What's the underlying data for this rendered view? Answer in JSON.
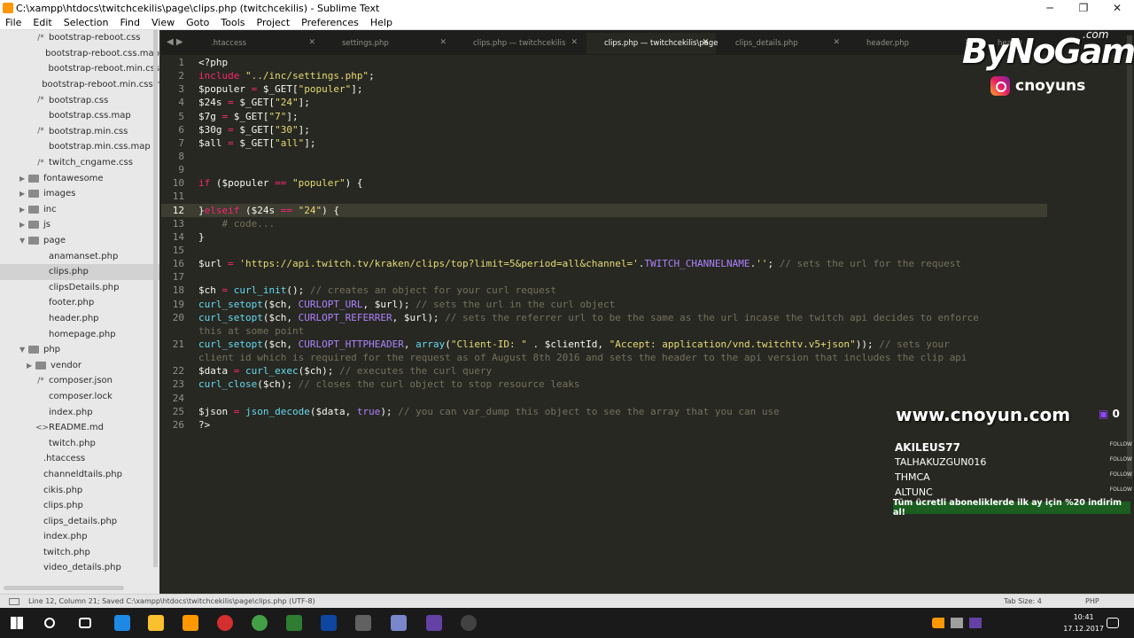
{
  "window": {
    "title": "C:\\xampp\\htdocs\\twitchcekilis\\page\\clips.php (twitchcekilis) - Sublime Text",
    "minimize": "─",
    "maximize": "❐",
    "close": "✕"
  },
  "menu": [
    "File",
    "Edit",
    "Selection",
    "Find",
    "View",
    "Goto",
    "Tools",
    "Project",
    "Preferences",
    "Help"
  ],
  "sidebar": {
    "items": [
      {
        "label": "bootstrap-reboot.css",
        "kind": "file",
        "glyph": "/*"
      },
      {
        "label": "bootstrap-reboot.css.map",
        "kind": "file",
        "glyph": ""
      },
      {
        "label": "bootstrap-reboot.min.css",
        "kind": "file",
        "glyph": ""
      },
      {
        "label": "bootstrap-reboot.min.css.r",
        "kind": "file",
        "glyph": ""
      },
      {
        "label": "bootstrap.css",
        "kind": "file",
        "glyph": "/*"
      },
      {
        "label": "bootstrap.css.map",
        "kind": "file",
        "glyph": ""
      },
      {
        "label": "bootstrap.min.css",
        "kind": "file",
        "glyph": "/*"
      },
      {
        "label": "bootstrap.min.css.map",
        "kind": "file",
        "glyph": ""
      },
      {
        "label": "twitch_cngame.css",
        "kind": "file",
        "glyph": "/*"
      },
      {
        "label": "fontawesome",
        "kind": "folder-closed"
      },
      {
        "label": "images",
        "kind": "folder-closed"
      },
      {
        "label": "inc",
        "kind": "folder-closed"
      },
      {
        "label": "js",
        "kind": "folder-closed"
      },
      {
        "label": "page",
        "kind": "folder-open"
      },
      {
        "label": "anamanset.php",
        "kind": "file",
        "glyph": ""
      },
      {
        "label": "clips.php",
        "kind": "file",
        "glyph": "",
        "selected": true
      },
      {
        "label": "clipsDetails.php",
        "kind": "file",
        "glyph": ""
      },
      {
        "label": "footer.php",
        "kind": "file",
        "glyph": ""
      },
      {
        "label": "header.php",
        "kind": "file",
        "glyph": ""
      },
      {
        "label": "homepage.php",
        "kind": "file",
        "glyph": ""
      },
      {
        "label": "php",
        "kind": "folder-open"
      },
      {
        "label": "vendor",
        "kind": "folder-closed-nested"
      },
      {
        "label": "composer.json",
        "kind": "file",
        "glyph": "/*"
      },
      {
        "label": "composer.lock",
        "kind": "file",
        "glyph": ""
      },
      {
        "label": "index.php",
        "kind": "file",
        "glyph": ""
      },
      {
        "label": "README.md",
        "kind": "file",
        "glyph": "<>"
      },
      {
        "label": "twitch.php",
        "kind": "file",
        "glyph": ""
      },
      {
        "label": ".htaccess",
        "kind": "root-file",
        "glyph": ""
      },
      {
        "label": "channeldtails.php",
        "kind": "root-file",
        "glyph": ""
      },
      {
        "label": "cikis.php",
        "kind": "root-file",
        "glyph": ""
      },
      {
        "label": "clips.php",
        "kind": "root-file",
        "glyph": ""
      },
      {
        "label": "clips_details.php",
        "kind": "root-file",
        "glyph": ""
      },
      {
        "label": "index.php",
        "kind": "root-file",
        "glyph": ""
      },
      {
        "label": "twitch.php",
        "kind": "root-file",
        "glyph": ""
      },
      {
        "label": "video_details.php",
        "kind": "root-file",
        "glyph": ""
      }
    ]
  },
  "tabs": [
    {
      "label": ".htaccess",
      "close": "✕"
    },
    {
      "label": "settings.php",
      "close": "✕"
    },
    {
      "label": "clips.php — twitchcekilis",
      "close": "✕"
    },
    {
      "label": "clips.php — twitchcekilis\\page",
      "close": "✕",
      "active": true
    },
    {
      "label": "clips_details.php",
      "close": "✕"
    },
    {
      "label": "header.php",
      "close": "✕"
    },
    {
      "label": "headD",
      "close": ""
    }
  ],
  "code": {
    "current_line": 12,
    "lines": [
      {
        "n": "1",
        "segs": [
          [
            "",
            "<?php"
          ]
        ]
      },
      {
        "n": "2",
        "segs": [
          [
            "kw",
            "include"
          ],
          [
            "",
            " "
          ],
          [
            "str",
            "\"../inc/settings.php\""
          ],
          [
            "",
            ";"
          ]
        ]
      },
      {
        "n": "3",
        "segs": [
          [
            "",
            "$populer "
          ],
          [
            "kw",
            "="
          ],
          [
            "",
            " $_GET["
          ],
          [
            "str",
            "\"populer\""
          ],
          [
            "",
            "];"
          ]
        ]
      },
      {
        "n": "4",
        "segs": [
          [
            "",
            "$24s "
          ],
          [
            "kw",
            "="
          ],
          [
            "",
            " $_GET["
          ],
          [
            "str",
            "\"24\""
          ],
          [
            "",
            "];"
          ]
        ]
      },
      {
        "n": "5",
        "segs": [
          [
            "",
            "$7g "
          ],
          [
            "kw",
            "="
          ],
          [
            "",
            " $_GET["
          ],
          [
            "str",
            "\"7\""
          ],
          [
            "",
            "];"
          ]
        ]
      },
      {
        "n": "6",
        "segs": [
          [
            "",
            "$30g "
          ],
          [
            "kw",
            "="
          ],
          [
            "",
            " $_GET["
          ],
          [
            "str",
            "\"30\""
          ],
          [
            "",
            "];"
          ]
        ]
      },
      {
        "n": "7",
        "segs": [
          [
            "",
            "$all "
          ],
          [
            "kw",
            "="
          ],
          [
            "",
            " $_GET["
          ],
          [
            "str",
            "\"all\""
          ],
          [
            "",
            "];"
          ]
        ]
      },
      {
        "n": "8",
        "segs": [
          [
            "",
            ""
          ]
        ]
      },
      {
        "n": "9",
        "segs": [
          [
            "",
            ""
          ]
        ]
      },
      {
        "n": "10",
        "segs": [
          [
            "kw",
            "if"
          ],
          [
            "",
            " ($populer "
          ],
          [
            "kw",
            "=="
          ],
          [
            "",
            " "
          ],
          [
            "str",
            "\"populer\""
          ],
          [
            "",
            ") {"
          ]
        ]
      },
      {
        "n": "11",
        "segs": [
          [
            "",
            ""
          ]
        ]
      },
      {
        "n": "12",
        "segs": [
          [
            "",
            "}"
          ],
          [
            "kw",
            "elseif"
          ],
          [
            "",
            " ($24s "
          ],
          [
            "kw",
            "=="
          ],
          [
            "",
            " "
          ],
          [
            "str",
            "\"24\""
          ],
          [
            "",
            ") {"
          ]
        ]
      },
      {
        "n": "13",
        "segs": [
          [
            "cm",
            "    # code..."
          ]
        ]
      },
      {
        "n": "14",
        "segs": [
          [
            "",
            "}"
          ]
        ]
      },
      {
        "n": "15",
        "segs": [
          [
            "",
            ""
          ]
        ]
      },
      {
        "n": "16",
        "segs": [
          [
            "",
            "$url "
          ],
          [
            "kw",
            "="
          ],
          [
            "",
            " "
          ],
          [
            "str",
            "'https://api.twitch.tv/kraken/clips/top?limit=5&period=all&channel='"
          ],
          [
            "",
            "."
          ],
          [
            "const",
            "TWITCH_CHANNELNAME"
          ],
          [
            "",
            "."
          ],
          [
            "str",
            "''"
          ],
          [
            "",
            "; "
          ],
          [
            "cm",
            "// sets the url for the request"
          ]
        ]
      },
      {
        "n": "17",
        "segs": [
          [
            "",
            ""
          ]
        ]
      },
      {
        "n": "18",
        "segs": [
          [
            "",
            "$ch "
          ],
          [
            "kw",
            "="
          ],
          [
            "",
            " "
          ],
          [
            "fn",
            "curl_init"
          ],
          [
            "",
            "(); "
          ],
          [
            "cm",
            "// creates an object for your curl request"
          ]
        ]
      },
      {
        "n": "19",
        "segs": [
          [
            "fn",
            "curl_setopt"
          ],
          [
            "",
            "($ch, "
          ],
          [
            "const",
            "CURLOPT_URL"
          ],
          [
            "",
            ", $url); "
          ],
          [
            "cm",
            "// sets the url in the curl object"
          ]
        ]
      },
      {
        "n": "20",
        "segs": [
          [
            "fn",
            "curl_setopt"
          ],
          [
            "",
            "($ch, "
          ],
          [
            "const",
            "CURLOPT_REFERRER"
          ],
          [
            "",
            ", $url); "
          ],
          [
            "cm",
            "// sets the referrer url to be the same as the url incase the twitch api decides to enforce"
          ]
        ]
      },
      {
        "n": "",
        "segs": [
          [
            "cm",
            "this at some point"
          ]
        ]
      },
      {
        "n": "21",
        "segs": [
          [
            "fn",
            "curl_setopt"
          ],
          [
            "",
            "($ch, "
          ],
          [
            "const",
            "CURLOPT_HTTPHEADER"
          ],
          [
            "",
            ", "
          ],
          [
            "fn",
            "array"
          ],
          [
            "",
            "("
          ],
          [
            "str",
            "\"Client-ID: \""
          ],
          [
            "",
            " . $clientId, "
          ],
          [
            "str",
            "\"Accept: application/vnd.twitchtv.v5+json\""
          ],
          [
            "",
            ")); "
          ],
          [
            "cm",
            "// sets your"
          ]
        ]
      },
      {
        "n": "",
        "segs": [
          [
            "cm",
            "client id which is required for the request as of August 8th 2016 and sets the header to the api version that includes the clip api"
          ]
        ]
      },
      {
        "n": "22",
        "segs": [
          [
            "",
            "$data "
          ],
          [
            "kw",
            "="
          ],
          [
            "",
            " "
          ],
          [
            "fn",
            "curl_exec"
          ],
          [
            "",
            "($ch); "
          ],
          [
            "cm",
            "// executes the curl query"
          ]
        ]
      },
      {
        "n": "23",
        "segs": [
          [
            "fn",
            "curl_close"
          ],
          [
            "",
            "($ch); "
          ],
          [
            "cm",
            "// closes the curl object to stop resource leaks"
          ]
        ]
      },
      {
        "n": "24",
        "segs": [
          [
            "",
            ""
          ]
        ]
      },
      {
        "n": "25",
        "segs": [
          [
            "",
            "$json "
          ],
          [
            "kw",
            "="
          ],
          [
            "",
            " "
          ],
          [
            "fn",
            "json_decode"
          ],
          [
            "",
            "($data, "
          ],
          [
            "const",
            "true"
          ],
          [
            "",
            "); "
          ],
          [
            "cm",
            "// you can var_dump this object to see the array that you can use"
          ]
        ]
      },
      {
        "n": "26",
        "segs": [
          [
            "",
            "?>"
          ]
        ]
      }
    ]
  },
  "status": {
    "left": "Line 12, Column 21; Saved C:\\xampp\\htdocs\\twitchcekilis\\page\\clips.php (UTF-8)",
    "tab_size": "Tab Size: 4",
    "syntax": "PHP"
  },
  "overlay": {
    "brand": "ByNoGame",
    "brand_sup": ".com",
    "instagram": "cnoyuns",
    "website": "www.cnoyun.com",
    "viewer_count": "0",
    "followers": [
      {
        "name": "AKILEUS77",
        "tag": "FOLLOW"
      },
      {
        "name": "TALHAKUZGUN016",
        "tag": "FOLLOW"
      },
      {
        "name": "THMCA",
        "tag": "FOLLOW"
      },
      {
        "name": "ALTUNC",
        "tag": "FOLLOW"
      }
    ],
    "promo": "Tüm ücretli aboneliklerde ilk ay için %20 indirim al!"
  },
  "taskbar": {
    "time": "10:41",
    "date": "17.12.2017"
  },
  "colors": {
    "editor_bg": "#272822",
    "keyword": "#f92672",
    "string": "#e6db74",
    "function": "#66d9ef",
    "comment": "#75715e",
    "constant": "#ae81ff"
  }
}
